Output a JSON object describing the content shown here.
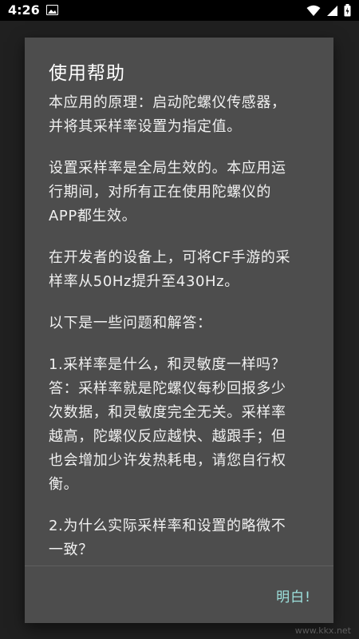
{
  "status_bar": {
    "time": "4:26",
    "icons": [
      "gallery-icon",
      "wifi-icon",
      "signal-icon",
      "battery-icon"
    ]
  },
  "dialog": {
    "title": "使用帮助",
    "paragraphs": [
      "本应用的原理：启动陀螺仪传感器，\n并将其采样率设置为指定值。",
      "设置采样率是全局生效的。本应用运\n行期间，对所有正在使用陀螺仪的\nAPP都生效。",
      "在开发者的设备上，可将CF手游的采\n样率从50Hz提升至430Hz。",
      "以下是一些问题和解答：",
      "1.采样率是什么，和灵敏度一样吗？\n答：采样率就是陀螺仪每秒回报多少\n次数据，和灵敏度完全无关。采样率\n越高，陀螺仪反应越快、越跟手；但\n也会增加少许发热耗电，请您自行权\n衡。",
      "2.为什么实际采样率和设置的略微不\n一致？"
    ],
    "ok_label": "明白!"
  },
  "watermark": "www.kkx.net",
  "colors": {
    "dialog_bg": "#4d4d4d",
    "accent": "#9ee3df",
    "text": "#f0f0f0"
  }
}
